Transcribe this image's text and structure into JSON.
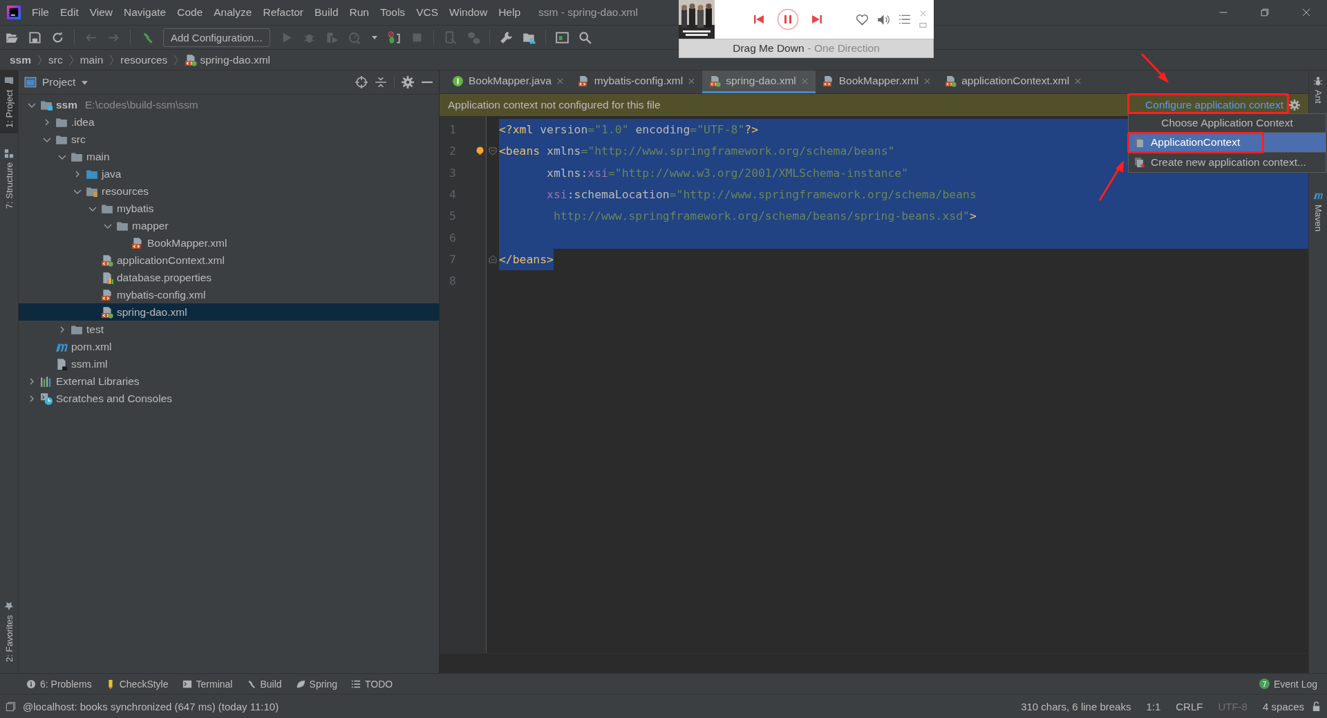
{
  "window": {
    "title": "ssm - spring-dao.xml"
  },
  "menu": [
    "File",
    "Edit",
    "View",
    "Navigate",
    "Code",
    "Analyze",
    "Refactor",
    "Build",
    "Run",
    "Tools",
    "VCS",
    "Window",
    "Help"
  ],
  "toolbar": {
    "run_configuration": "Add Configuration..."
  },
  "breadcrumb": [
    {
      "label": "ssm",
      "kind": "project"
    },
    {
      "label": "src",
      "kind": "folder"
    },
    {
      "label": "main",
      "kind": "folder"
    },
    {
      "label": "resources",
      "kind": "folder"
    },
    {
      "label": "spring-dao.xml",
      "kind": "spring-xml"
    }
  ],
  "music_player": {
    "song": "Drag Me Down",
    "artist": "- One Direction",
    "playing": true
  },
  "left_stripe": [
    {
      "label": "1: Project",
      "kind": "project",
      "selected": true
    },
    {
      "label": "7: Structure",
      "kind": "structure",
      "selected": false
    },
    {
      "label": "2: Favorites",
      "kind": "favorites",
      "selected": false
    }
  ],
  "right_stripe": [
    {
      "label": "Ant",
      "kind": "ant"
    },
    {
      "label": "Maven",
      "kind": "maven"
    }
  ],
  "project_panel": {
    "title": "Project",
    "tree": [
      {
        "label": "ssm",
        "path": "E:\\codes\\build-ssm\\ssm",
        "kind": "module",
        "expanded": true,
        "selected": false,
        "children": [
          {
            "label": ".idea",
            "kind": "folder",
            "expanded": false,
            "selected": false
          },
          {
            "label": "src",
            "kind": "folder",
            "expanded": true,
            "selected": false,
            "children": [
              {
                "label": "main",
                "kind": "folder",
                "expanded": true,
                "selected": false,
                "children": [
                  {
                    "label": "java",
                    "kind": "source-folder",
                    "expanded": false,
                    "selected": false
                  },
                  {
                    "label": "resources",
                    "kind": "resources-folder",
                    "expanded": true,
                    "selected": false,
                    "children": [
                      {
                        "label": "mybatis",
                        "kind": "folder",
                        "expanded": true,
                        "selected": false,
                        "children": [
                          {
                            "label": "mapper",
                            "kind": "folder",
                            "expanded": true,
                            "selected": false,
                            "children": [
                              {
                                "label": "BookMapper.xml",
                                "kind": "xml",
                                "selected": false
                              }
                            ]
                          }
                        ]
                      },
                      {
                        "label": "applicationContext.xml",
                        "kind": "spring-xml",
                        "selected": false
                      },
                      {
                        "label": "database.properties",
                        "kind": "properties",
                        "selected": false
                      },
                      {
                        "label": "mybatis-config.xml",
                        "kind": "xml",
                        "selected": false
                      },
                      {
                        "label": "spring-dao.xml",
                        "kind": "spring-xml",
                        "selected": true
                      }
                    ]
                  }
                ]
              },
              {
                "label": "test",
                "kind": "folder",
                "expanded": false,
                "selected": false
              }
            ]
          },
          {
            "label": "pom.xml",
            "kind": "maven",
            "selected": false
          },
          {
            "label": "ssm.iml",
            "kind": "iml",
            "selected": false
          }
        ]
      },
      {
        "label": "External Libraries",
        "kind": "libraries",
        "expanded": false,
        "selected": false
      },
      {
        "label": "Scratches and Consoles",
        "kind": "scratches",
        "expanded": false,
        "selected": false
      }
    ]
  },
  "editor": {
    "tabs": [
      {
        "label": "BookMapper.java",
        "kind": "java",
        "selected": false
      },
      {
        "label": "mybatis-config.xml",
        "kind": "xml",
        "selected": false
      },
      {
        "label": "spring-dao.xml",
        "kind": "spring-xml",
        "selected": true
      },
      {
        "label": "BookMapper.xml",
        "kind": "xml",
        "selected": false
      },
      {
        "label": "applicationContext.xml",
        "kind": "spring-xml",
        "selected": false
      }
    ],
    "notification": {
      "text": "Application context not configured for this file",
      "link": "Configure application context"
    },
    "lines": [
      {
        "number": "1",
        "selected": true,
        "selection_end": false,
        "fold_start": false,
        "fold_end": false,
        "bulb": false,
        "tokens": [
          {
            "text": "<?xml",
            "kind": "tag"
          },
          {
            "text": " version",
            "kind": "attr"
          },
          {
            "text": "=\"1.0\"",
            "kind": "value"
          },
          {
            "text": " encoding",
            "kind": "attr"
          },
          {
            "text": "=\"UTF-8\"",
            "kind": "value"
          },
          {
            "text": "?>",
            "kind": "tag"
          }
        ]
      },
      {
        "number": "2",
        "selected": true,
        "selection_end": false,
        "fold_start": true,
        "fold_end": false,
        "bulb": true,
        "tokens": [
          {
            "text": "<beans",
            "kind": "tag"
          },
          {
            "text": " xmlns",
            "kind": "attr"
          },
          {
            "text": "=\"http://www.springframework.org/schema/beans\"",
            "kind": "value"
          }
        ]
      },
      {
        "number": "3",
        "selected": true,
        "selection_end": false,
        "fold_start": false,
        "fold_end": false,
        "bulb": false,
        "tokens": [
          {
            "text": "       xmlns:",
            "kind": "attr"
          },
          {
            "text": "xsi",
            "kind": "ns"
          },
          {
            "text": "=\"http://www.w3.org/2001/XMLSchema-instance\"",
            "kind": "value"
          }
        ]
      },
      {
        "number": "4",
        "selected": true,
        "selection_end": false,
        "fold_start": false,
        "fold_end": false,
        "bulb": false,
        "tokens": [
          {
            "text": "       xsi",
            "kind": "ns"
          },
          {
            "text": ":schemaLocation",
            "kind": "attr"
          },
          {
            "text": "=\"http://www.springframework.org/schema/beans",
            "kind": "value"
          }
        ]
      },
      {
        "number": "5",
        "selected": true,
        "selection_end": false,
        "fold_start": false,
        "fold_end": false,
        "bulb": false,
        "tokens": [
          {
            "text": "        http://www.springframework.org/schema/beans/spring-beans.xsd\"",
            "kind": "value"
          },
          {
            "text": ">",
            "kind": "tag"
          }
        ]
      },
      {
        "number": "6",
        "selected": true,
        "selection_end": false,
        "fold_start": false,
        "fold_end": false,
        "bulb": false
      },
      {
        "number": "7",
        "selected": true,
        "selection_end": true,
        "fold_start": false,
        "fold_end": true,
        "bulb": false,
        "tokens": [
          {
            "text": "</beans>",
            "kind": "tag"
          }
        ]
      },
      {
        "number": "8",
        "selected": false,
        "fold_start": false,
        "fold_end": false,
        "bulb": false
      }
    ],
    "popup": {
      "title": "Choose Application Context",
      "items": [
        {
          "label": "ApplicationContext",
          "kind": "context",
          "selected": true
        },
        {
          "label": "Create new application context...",
          "kind": "new",
          "selected": false
        }
      ]
    }
  },
  "tool_windows": [
    {
      "label": "6: Problems",
      "kind": "problems"
    },
    {
      "label": "CheckStyle",
      "kind": "checkstyle"
    },
    {
      "label": "Terminal",
      "kind": "terminal"
    },
    {
      "label": "Build",
      "kind": "build"
    },
    {
      "label": "Spring",
      "kind": "spring"
    },
    {
      "label": "TODO",
      "kind": "todo"
    }
  ],
  "event_log": {
    "label": "Event Log",
    "count": "7"
  },
  "status_bar": {
    "message": "@localhost: books synchronized (647 ms) (today 11:10)",
    "items": [
      {
        "text": "310 chars, 6 line breaks",
        "disabled": false
      },
      {
        "text": "1:1",
        "disabled": false
      },
      {
        "text": "CRLF",
        "disabled": false
      },
      {
        "text": "UTF-8",
        "disabled": true
      },
      {
        "text": "4 spaces",
        "disabled": false
      }
    ]
  }
}
